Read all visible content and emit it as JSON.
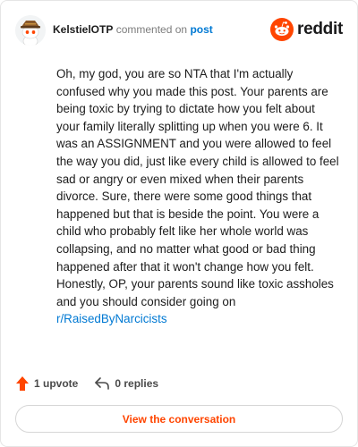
{
  "header": {
    "username": "KelstielOTP",
    "commented_text": "commented on",
    "post_link": "post",
    "brand": "reddit"
  },
  "comment": {
    "text": "Oh, my god, you are so NTA that I'm actually confused why you made this post. Your parents are being toxic by trying to dictate how you felt about your family literally splitting up when you were 6. It was an ASSIGNMENT and you were allowed to feel the way you did, just like every child is allowed to feel sad or angry or even mixed when their parents divorce. Sure, there were some good things that happened but that is beside the point. You were a child who probably felt like her whole world was collapsing, and no matter what good or bad thing happened after that it won't change how you felt. Honestly, OP, your parents sound like toxic assholes and you should consider going on ",
    "subreddit_link": "r/RaisedByNarcicists"
  },
  "actions": {
    "upvotes": "1 upvote",
    "replies": "0 replies"
  },
  "cta": {
    "label": "View the conversation"
  },
  "colors": {
    "brand_orange": "#ff4500",
    "link_blue": "#0079d3",
    "upvote_orange": "#ff4500"
  },
  "icons": {
    "avatar": "snoo-avatar-icon",
    "logo": "reddit-logo-icon",
    "upvote": "upvote-arrow-icon",
    "reply": "reply-arrow-icon"
  }
}
